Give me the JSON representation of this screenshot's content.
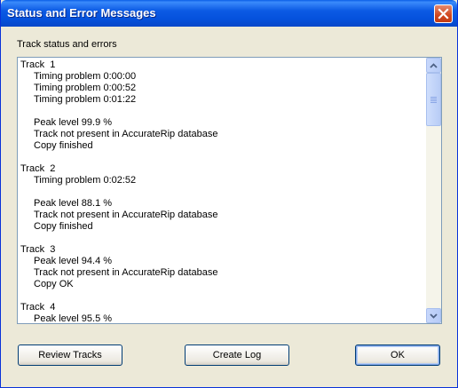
{
  "window": {
    "title": "Status and Error Messages"
  },
  "group_label": "Track status and errors",
  "log_lines": [
    {
      "text": "Track  1",
      "indent": false
    },
    {
      "text": "Timing problem 0:00:00",
      "indent": true
    },
    {
      "text": "Timing problem 0:00:52",
      "indent": true
    },
    {
      "text": "Timing problem 0:01:22",
      "indent": true
    },
    {
      "text": "",
      "indent": true
    },
    {
      "text": "Peak level 99.9 %",
      "indent": true
    },
    {
      "text": "Track not present in AccurateRip database",
      "indent": true
    },
    {
      "text": "Copy finished",
      "indent": true
    },
    {
      "text": "",
      "indent": false
    },
    {
      "text": "Track  2",
      "indent": false
    },
    {
      "text": "Timing problem 0:02:52",
      "indent": true
    },
    {
      "text": "",
      "indent": true
    },
    {
      "text": "Peak level 88.1 %",
      "indent": true
    },
    {
      "text": "Track not present in AccurateRip database",
      "indent": true
    },
    {
      "text": "Copy finished",
      "indent": true
    },
    {
      "text": "",
      "indent": false
    },
    {
      "text": "Track  3",
      "indent": false
    },
    {
      "text": "Peak level 94.4 %",
      "indent": true
    },
    {
      "text": "Track not present in AccurateRip database",
      "indent": true
    },
    {
      "text": "Copy OK",
      "indent": true
    },
    {
      "text": "",
      "indent": false
    },
    {
      "text": "Track  4",
      "indent": false
    },
    {
      "text": "Peak level 95.5 %",
      "indent": true
    }
  ],
  "buttons": {
    "review": "Review Tracks",
    "create_log": "Create Log",
    "ok": "OK"
  }
}
